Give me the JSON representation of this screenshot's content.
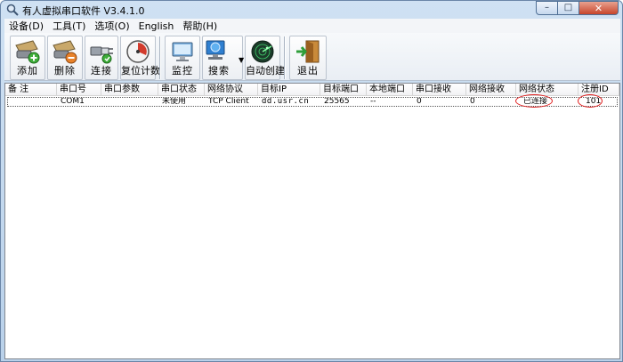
{
  "window": {
    "title": "有人虚拟串口软件 V3.4.1.0",
    "controls": {
      "minimize": "–",
      "maximize": "□",
      "close": "✕"
    }
  },
  "menu": [
    "设备(D)",
    "工具(T)",
    "选项(O)",
    "English",
    "帮助(H)"
  ],
  "toolbar": {
    "add": "添加",
    "delete": "删除",
    "connect": "连接",
    "reset_count": "复位计数",
    "monitor": "监控",
    "search": "搜索",
    "auto_create": "自动创建",
    "exit": "退出"
  },
  "columns": [
    "备 注",
    "串口号",
    "串口参数",
    "串口状态",
    "网络协议",
    "目标IP",
    "目标端口",
    "本地端口",
    "串口接收",
    "网络接收",
    "网络状态",
    "注册ID"
  ],
  "rows": [
    {
      "note": "",
      "port": "COM1",
      "params": "",
      "port_status": "未使用",
      "protocol": "TCP Client",
      "target_ip": "dd.usr.cn",
      "target_port": "25565",
      "local_port": "--",
      "serial_rx": "0",
      "net_rx": "0",
      "net_status": "已连接",
      "reg_id": "101"
    }
  ],
  "colors": {
    "highlight_ring": "#e01b1b",
    "title_bg": "#c4d9ef"
  },
  "icons": {
    "app": "magnifier-icon",
    "add": "serial-plug-add-icon",
    "delete": "serial-plug-remove-icon",
    "connect": "plug-connect-icon",
    "reset_count": "gauge-reset-icon",
    "monitor": "monitor-icon",
    "search": "network-search-icon",
    "auto_create": "radar-icon",
    "exit": "exit-door-icon"
  }
}
